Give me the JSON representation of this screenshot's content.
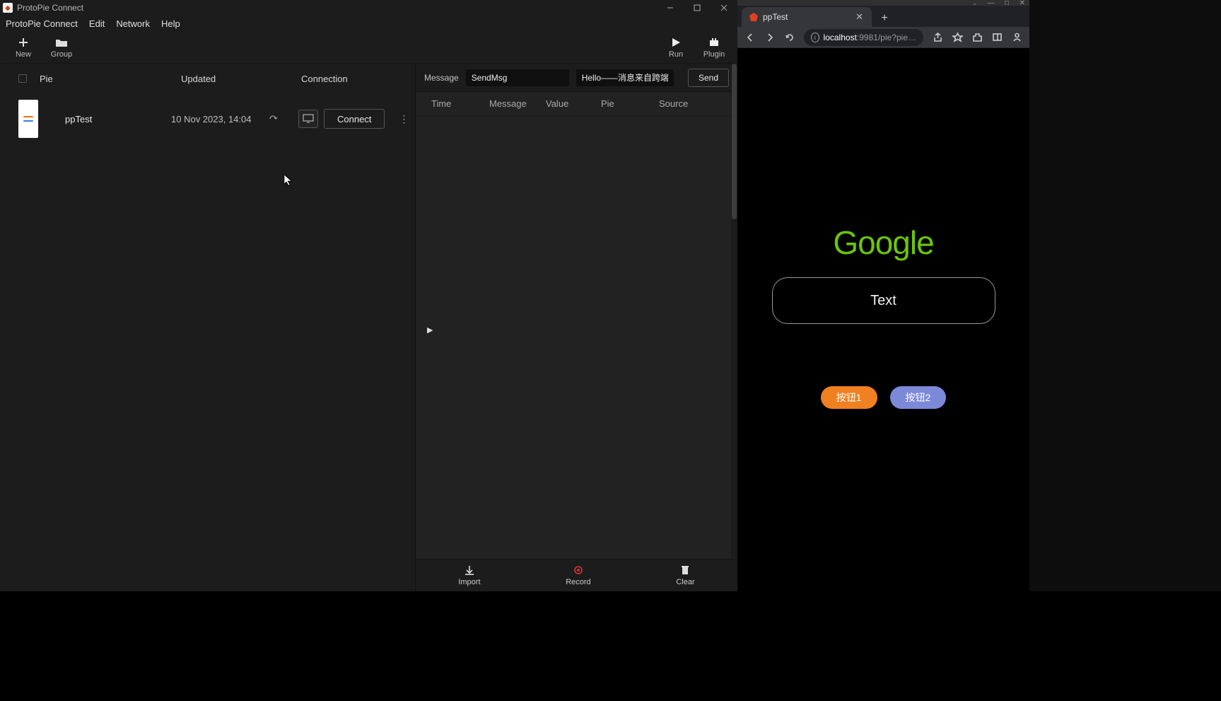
{
  "protopie": {
    "titlebar": "ProtoPie Connect",
    "menu": {
      "app": "ProtoPie Connect",
      "edit": "Edit",
      "network": "Network",
      "help": "Help"
    },
    "toolbar": {
      "new": "New",
      "group": "Group",
      "run": "Run",
      "plugin": "Plugin"
    },
    "list": {
      "headers": {
        "pie": "Pie",
        "updated": "Updated",
        "connection": "Connection"
      },
      "rows": [
        {
          "name": "ppTest",
          "updated": "10 Nov 2023, 14:04",
          "connect": "Connect"
        }
      ]
    },
    "msgbar": {
      "label": "Message",
      "message_value": "SendMsg",
      "value_value": "Hello——消息来自跨端发送",
      "send": "Send"
    },
    "logheaders": {
      "time": "Time",
      "message": "Message",
      "value": "Value",
      "pie": "Pie",
      "source": "Source"
    },
    "bottom": {
      "import": "Import",
      "record": "Record",
      "clear": "Clear"
    }
  },
  "browser": {
    "wincontrols": true,
    "tab_title": "ppTest",
    "url_host": "localhost",
    "url_port_path": ":9981/pie?pie…",
    "page": {
      "logo": "Google",
      "textbox": "Text",
      "btn1": "按钮1",
      "btn2": "按钮2"
    }
  }
}
